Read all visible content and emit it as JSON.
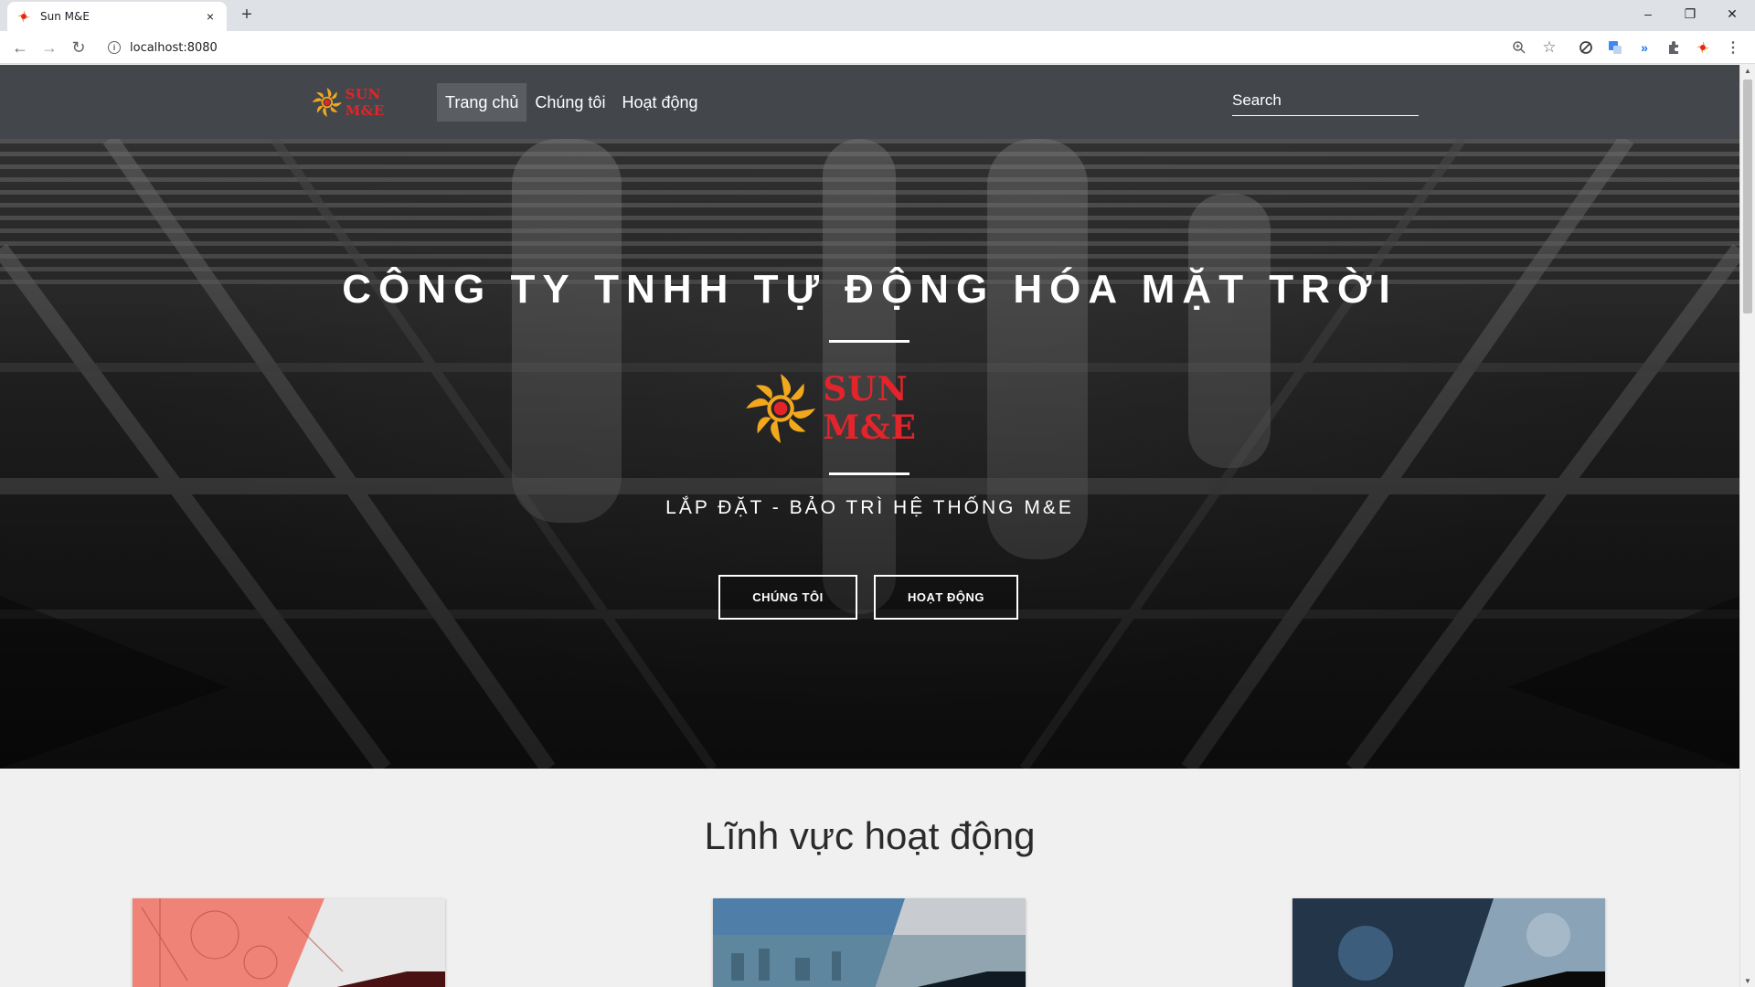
{
  "browser": {
    "tab_title": "Sun M&E",
    "tab_close": "×",
    "new_tab": "+",
    "url": "localhost:8080",
    "window_controls": [
      "–",
      "❐",
      "✕"
    ]
  },
  "nav": {
    "logo_text": "SUN M&E",
    "links": [
      "Trang chủ",
      "Chúng tôi",
      "Hoạt động"
    ],
    "active_index": 0,
    "search_placeholder": "Search"
  },
  "hero": {
    "title": "CÔNG TY TNHH TỰ ĐỘNG HÓA MẶT TRỜI",
    "logo_text": "SUN M&E",
    "subtitle": "LẮP ĐẶT - BẢO TRÌ HỆ THỐNG M&E",
    "buttons": [
      "CHÚNG TÔI",
      "HOẠT ĐỘNG"
    ]
  },
  "section": {
    "title": "Lĩnh vực hoạt động"
  },
  "colors": {
    "nav_bg": "#43464b",
    "brand_red": "#e3242b",
    "brand_gold": "#f2a81d"
  }
}
